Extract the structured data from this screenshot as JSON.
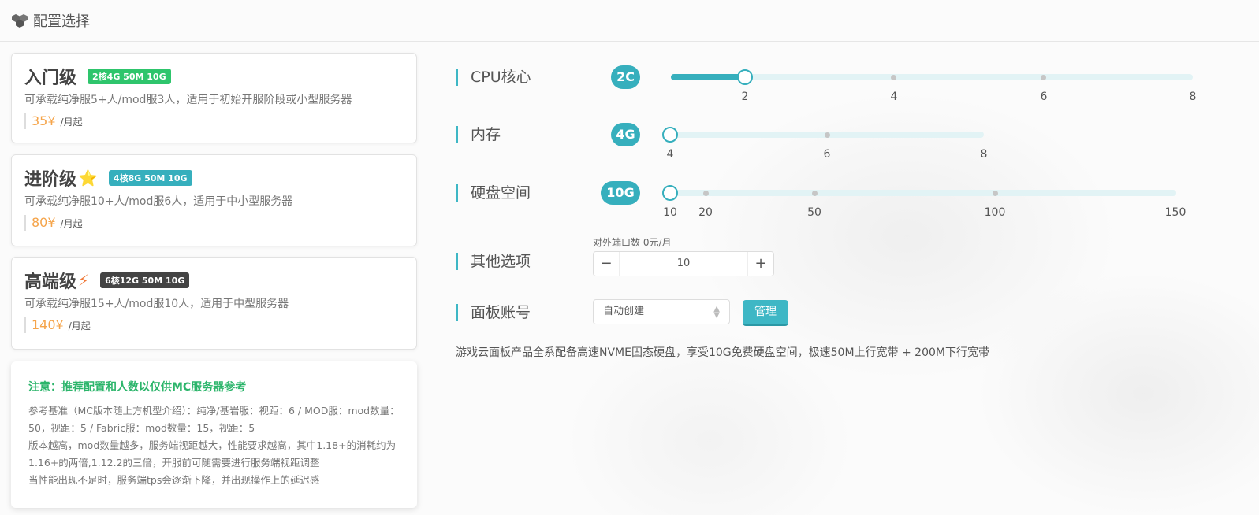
{
  "header": {
    "title": "配置选择",
    "icon": "cubes-icon"
  },
  "plans": [
    {
      "name": "入门级",
      "badge": "2核4G 50M 10G",
      "badge_color": "#2ec56c",
      "emoji": "",
      "desc": "可承载纯净服5+人/mod服3人，适用于初始开服阶段或小型服务器",
      "price": "35¥",
      "per": "/月起"
    },
    {
      "name": "进阶级",
      "badge": "4核8G 50M 10G",
      "badge_color": "#36afbd",
      "emoji": "⭐",
      "desc": "可承载纯净服10+人/mod服6人，适用于中小型服务器",
      "price": "80¥",
      "per": "/月起"
    },
    {
      "name": "高端级",
      "badge": "6核12G 50M 10G",
      "badge_color": "#444444",
      "emoji": "⚡",
      "desc": "可承载纯净服15+人/mod服10人，适用于中型服务器",
      "price": "140¥",
      "per": "/月起"
    }
  ],
  "note": {
    "title": "注意：推荐配置和人数以仅供MC服务器参考",
    "lines": [
      "参考基准（MC版本随上方机型介绍）：纯净/基岩服：视距：6 / MOD服：mod数量：50，视距：5 / Fabric服：mod数量：15，视距：5",
      "版本越高，mod数量越多，服务端视距越大，性能要求越高，其中1.18+的消耗约为1.16+的两倍,1.12.2的三倍，开服前可随需要进行服务端视距调整",
      "当性能出现不足时，服务端tps会逐渐下降，并出现操作上的延迟感"
    ]
  },
  "cpu": {
    "label": "CPU核心",
    "value": "2C",
    "ticks": [
      "2",
      "4",
      "6",
      "8"
    ],
    "selected": 2
  },
  "memory": {
    "label": "内存",
    "value": "4G",
    "ticks": [
      "4",
      "6",
      "8"
    ],
    "selected": 4
  },
  "disk": {
    "label": "硬盘空间",
    "value": "10G",
    "ticks": [
      "10",
      "20",
      "50",
      "100",
      "150"
    ],
    "selected": 10
  },
  "other": {
    "label": "其他选项",
    "port_caption": "对外端口数 0元/月",
    "port_value": "10",
    "minus": "−",
    "plus": "+"
  },
  "panel": {
    "label": "面板账号",
    "select_value": "自动创建",
    "manage_label": "管理"
  },
  "footer": "游戏云面板产品全系配备高速NVME固态硬盘，享受10G免费硬盘空间，极速50M上行宽带 + 200M下行宽带",
  "colors": {
    "accent": "#36afbd",
    "price": "#f5a44a",
    "note_title": "#2cb56b"
  }
}
